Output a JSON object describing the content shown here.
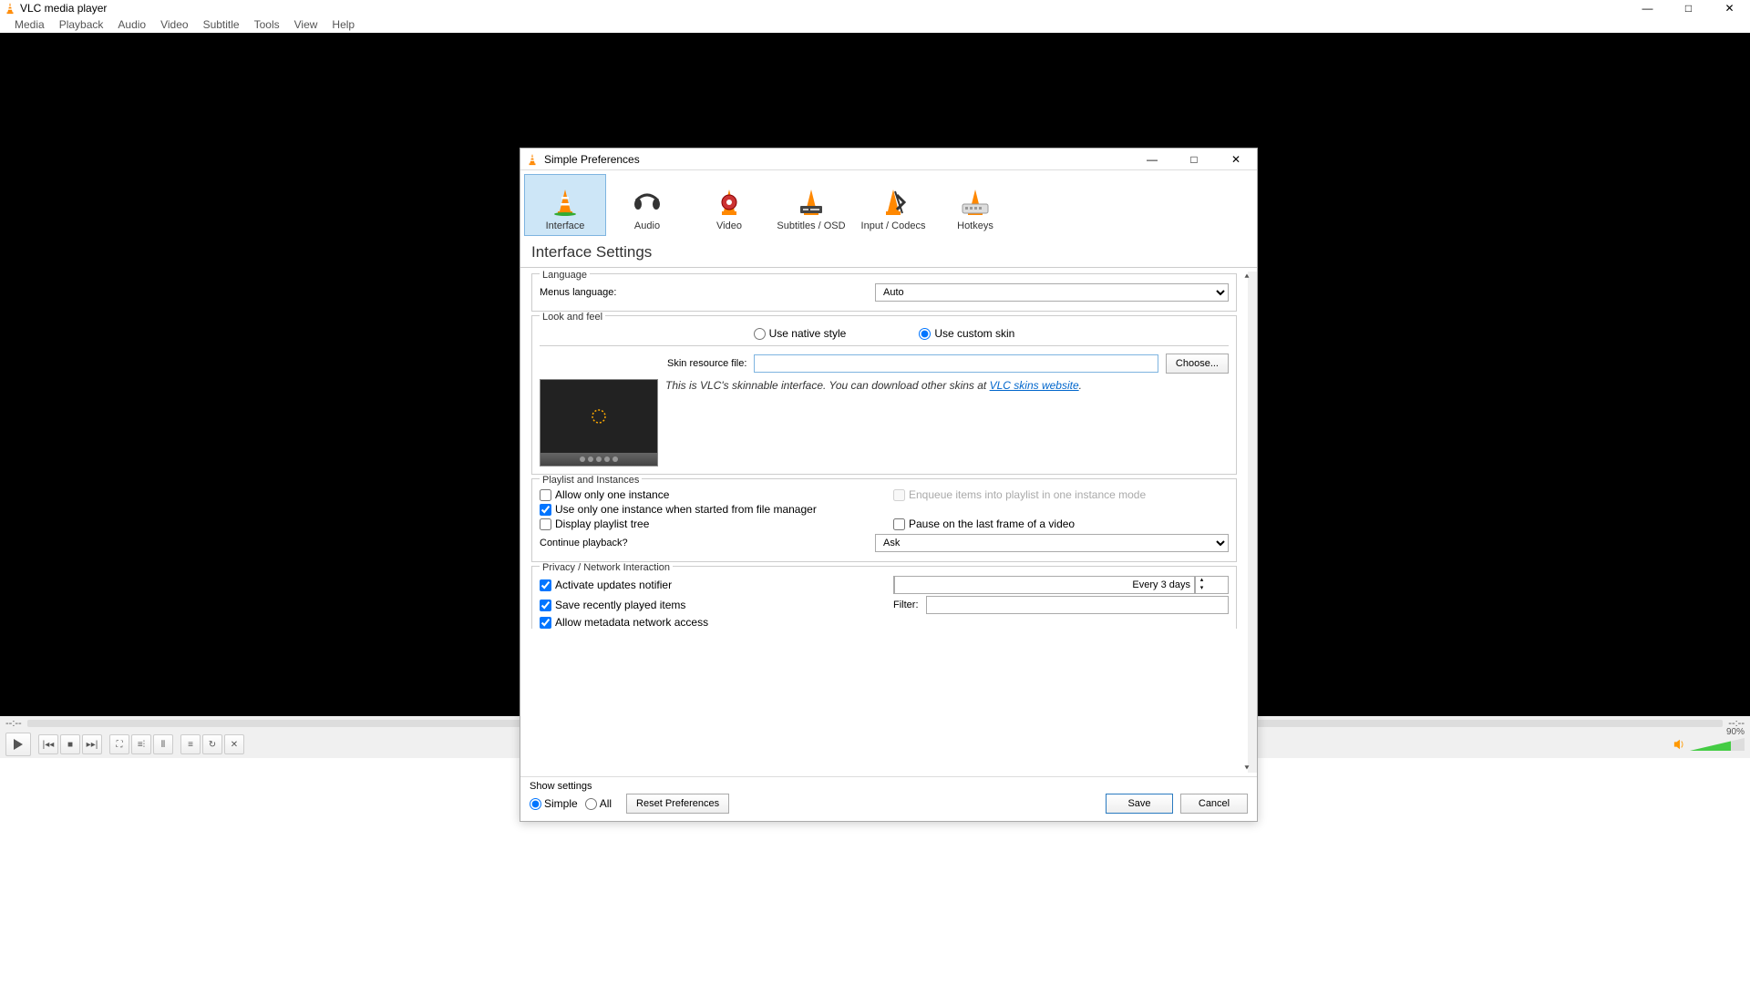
{
  "app": {
    "title": "VLC media player"
  },
  "menu": [
    "Media",
    "Playback",
    "Audio",
    "Video",
    "Subtitle",
    "Tools",
    "View",
    "Help"
  ],
  "time": {
    "left": "--:--",
    "right": "--:--"
  },
  "volume": {
    "label": "90%"
  },
  "dialog": {
    "title": "Simple Preferences",
    "categories": [
      "Interface",
      "Audio",
      "Video",
      "Subtitles / OSD",
      "Input / Codecs",
      "Hotkeys"
    ],
    "section_title": "Interface Settings",
    "language": {
      "group": "Language",
      "label": "Menus language:",
      "value": "Auto"
    },
    "look": {
      "group": "Look and feel",
      "native": "Use native style",
      "custom": "Use custom skin",
      "skin_label": "Skin resource file:",
      "skin_value": "",
      "choose": "Choose...",
      "info_prefix": "This is VLC's skinnable interface. You can download other skins at ",
      "info_link": "VLC skins website",
      "info_suffix": "."
    },
    "playlist": {
      "group": "Playlist and Instances",
      "one_instance": "Allow only one instance",
      "enqueue": "Enqueue items into playlist in one instance mode",
      "one_from_fm": "Use only one instance when started from file manager",
      "display_tree": "Display playlist tree",
      "pause_last": "Pause on the last frame of a video",
      "continue_label": "Continue playback?",
      "continue_value": "Ask"
    },
    "privacy": {
      "group": "Privacy / Network Interaction",
      "updates": "Activate updates notifier",
      "updates_value": "Every 3 days",
      "save_recent": "Save recently played items",
      "filter_label": "Filter:",
      "filter_value": "",
      "metadata": "Allow metadata network access"
    },
    "footer": {
      "show_settings": "Show settings",
      "simple": "Simple",
      "all": "All",
      "reset": "Reset Preferences",
      "save": "Save",
      "cancel": "Cancel"
    }
  }
}
